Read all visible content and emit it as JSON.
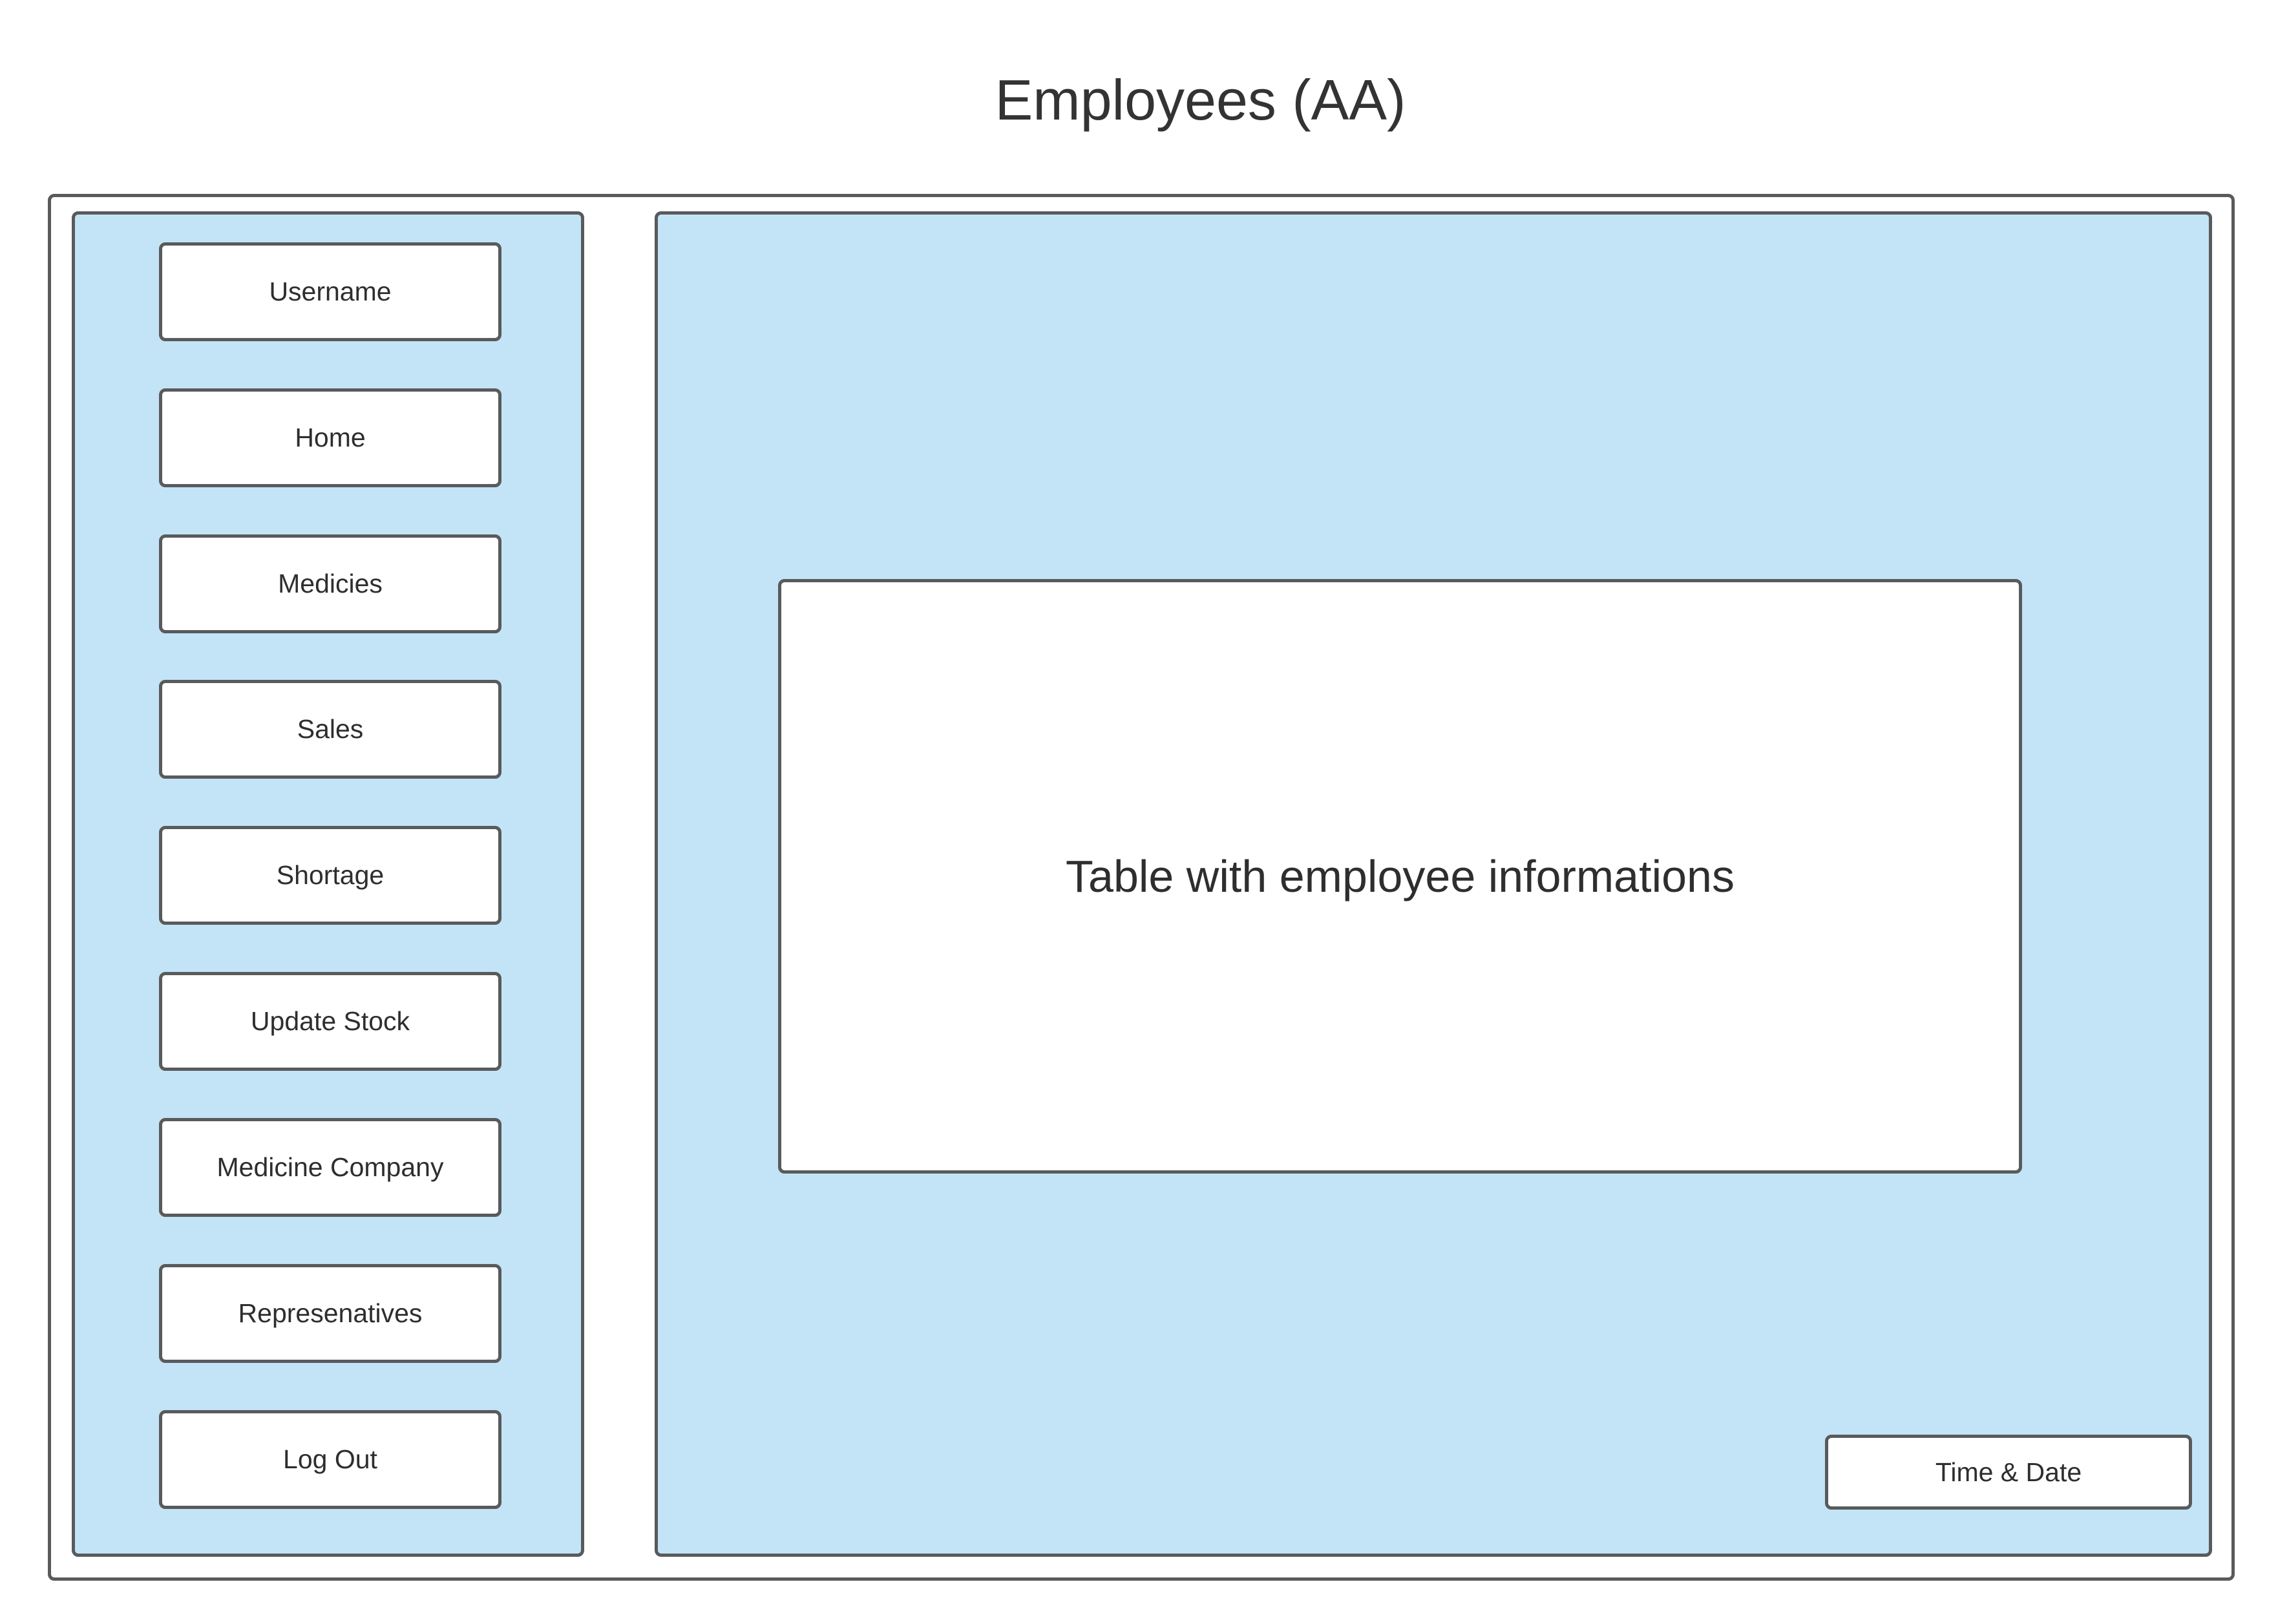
{
  "page": {
    "title": "Employees (AA)"
  },
  "sidebar": {
    "items": [
      {
        "label": "Username"
      },
      {
        "label": "Home"
      },
      {
        "label": "Medicies"
      },
      {
        "label": "Sales"
      },
      {
        "label": "Shortage"
      },
      {
        "label": "Update Stock"
      },
      {
        "label": "Medicine Company"
      },
      {
        "label": "Represenatives"
      },
      {
        "label": "Log Out"
      }
    ]
  },
  "main": {
    "table_placeholder": "Table with employee informations",
    "time_date": "Time & Date"
  },
  "colors": {
    "panel_background": "#c3e4f6",
    "border": "#595a5c",
    "box_background": "#ffffff",
    "text": "#2e2e2e"
  }
}
